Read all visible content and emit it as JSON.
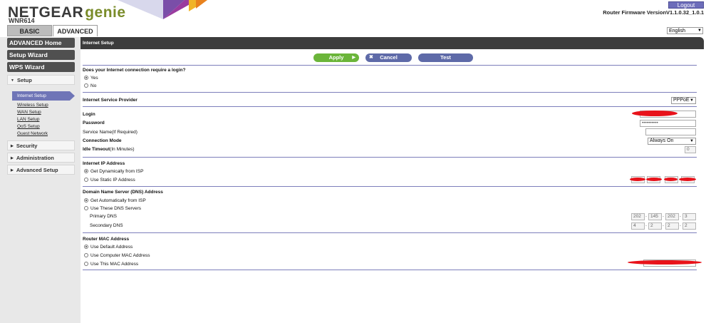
{
  "header": {
    "logo_brand": "NETGEAR",
    "logo_genie": "genie",
    "model": "WNR614",
    "tabs": [
      "BASIC",
      "ADVANCED"
    ],
    "logout": "Logout",
    "firmware": "Router Firmware VersionV1.1.0.32_1.0.1",
    "language": "English"
  },
  "sidebar": {
    "buttons": [
      "ADVANCED Home",
      "Setup Wizard",
      "WPS Wizard"
    ],
    "sections": [
      "Setup",
      "Security",
      "Administration",
      "Advanced Setup"
    ],
    "setup_items": [
      "Internet Setup",
      "Wireless Setup",
      "WAN Setup",
      "LAN Setup",
      "QoS Setup",
      "Guest Network"
    ]
  },
  "main": {
    "title": "Internet Setup",
    "buttons": {
      "apply": "Apply",
      "cancel": "Cancel",
      "test": "Test"
    },
    "login_question": "Does your Internet connection require a login?",
    "login_yes": "Yes",
    "login_no": "No",
    "isp_label": "Internet Service Provider",
    "isp_value": "PPPoE",
    "login_label": "Login",
    "password_label": "Password",
    "password_value": "••••••••••",
    "service_name_label": "Service Name",
    "service_name_hint": "(If Required)",
    "connection_mode_label": "Connection Mode",
    "connection_mode_value": "Always On",
    "idle_timeout_label": "Idle Timeout",
    "idle_timeout_hint": "(In Minutes)",
    "idle_timeout_value": "0",
    "ip_heading": "Internet IP Address",
    "ip_dynamic": "Get Dynamically from ISP",
    "ip_static": "Use Static IP Address",
    "dns_heading": "Domain Name Server (DNS) Address",
    "dns_auto": "Get Automatically from ISP",
    "dns_these": "Use These DNS Servers",
    "primary_dns_label": "Primary DNS",
    "primary_dns": [
      "202",
      "145",
      "202",
      "3"
    ],
    "secondary_dns_label": "Secondary DNS",
    "secondary_dns": [
      "4",
      "2",
      "2",
      "2"
    ],
    "mac_heading": "Router MAC Address",
    "mac_default": "Use Default Address",
    "mac_computer": "Use Computer MAC Address",
    "mac_this": "Use This MAC Address"
  }
}
